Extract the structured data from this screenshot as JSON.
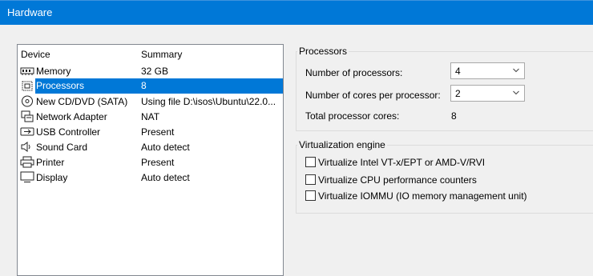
{
  "window": {
    "title": "Hardware"
  },
  "device_list": {
    "columns": {
      "device": "Device",
      "summary": "Summary"
    },
    "items": [
      {
        "name": "Memory",
        "summary": "32 GB",
        "icon": "memory-icon"
      },
      {
        "name": "Processors",
        "summary": "8",
        "icon": "processor-icon",
        "selected": true
      },
      {
        "name": "New CD/DVD (SATA)",
        "summary": "Using file D:\\isos\\Ubuntu\\22.0...",
        "icon": "cd-dvd-icon"
      },
      {
        "name": "Network Adapter",
        "summary": "NAT",
        "icon": "network-adapter-icon"
      },
      {
        "name": "USB Controller",
        "summary": "Present",
        "icon": "usb-icon"
      },
      {
        "name": "Sound Card",
        "summary": "Auto detect",
        "icon": "speaker-icon"
      },
      {
        "name": "Printer",
        "summary": "Present",
        "icon": "printer-icon"
      },
      {
        "name": "Display",
        "summary": "Auto detect",
        "icon": "monitor-icon"
      }
    ]
  },
  "processors": {
    "group_title": "Processors",
    "num_processors_label": "Number of processors:",
    "num_processors_value": "4",
    "cores_per_processor_label": "Number of cores per processor:",
    "cores_per_processor_value": "2",
    "total_cores_label": "Total processor cores:",
    "total_cores_value": "8"
  },
  "virtualization": {
    "group_title": "Virtualization engine",
    "options": [
      {
        "label": "Virtualize Intel VT-x/EPT or AMD-V/RVI",
        "checked": false
      },
      {
        "label": "Virtualize CPU performance counters",
        "checked": false
      },
      {
        "label": "Virtualize IOMMU (IO memory management unit)",
        "checked": false
      }
    ]
  },
  "colors": {
    "accent": "#0078d7",
    "background": "#f0f0f0"
  }
}
